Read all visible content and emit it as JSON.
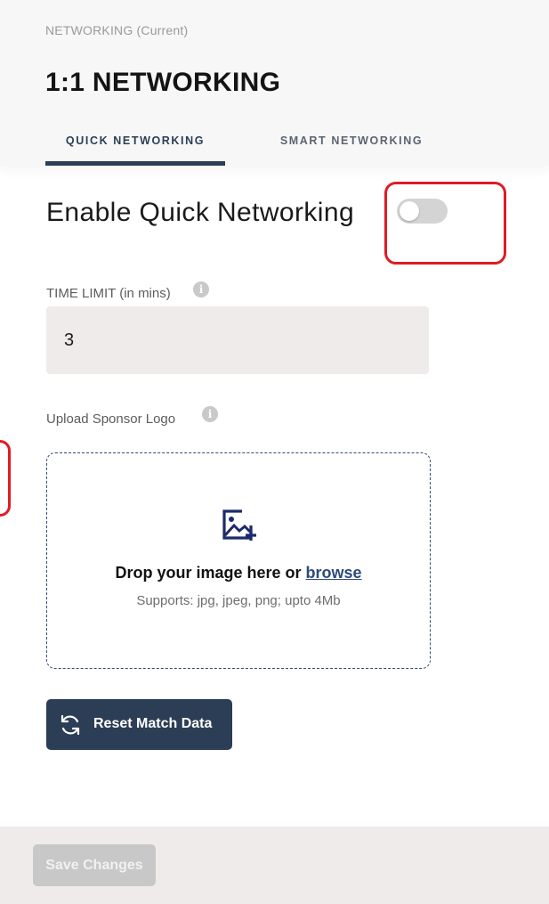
{
  "header": {
    "breadcrumb": "NETWORKING (Current)",
    "title": "1:1 NETWORKING",
    "tabs": [
      {
        "label": "QUICK NETWORKING",
        "active": true
      },
      {
        "label": "SMART NETWORKING",
        "active": false
      }
    ]
  },
  "enable": {
    "label": "Enable Quick Networking",
    "enabled": false
  },
  "time_limit": {
    "label": "TIME LIMIT (in mins)",
    "value": "3",
    "info_icon": "info-icon"
  },
  "sponsor_logo": {
    "label": "Upload Sponsor Logo",
    "info_icon": "info-icon",
    "drop_text": "Drop your image here or ",
    "browse_label": "browse",
    "supports_text": "Supports: jpg, jpeg, png; upto 4Mb",
    "icon": "image-plus-icon"
  },
  "actions": {
    "reset_label": "Reset Match Data",
    "reset_icon": "refresh-icon",
    "save_label": "Save Changes",
    "save_enabled": false
  },
  "colors": {
    "primary": "#2c3e55",
    "highlight": "#e01b24",
    "input_bg": "#efebea",
    "toggle_off": "#d4d4d4"
  }
}
